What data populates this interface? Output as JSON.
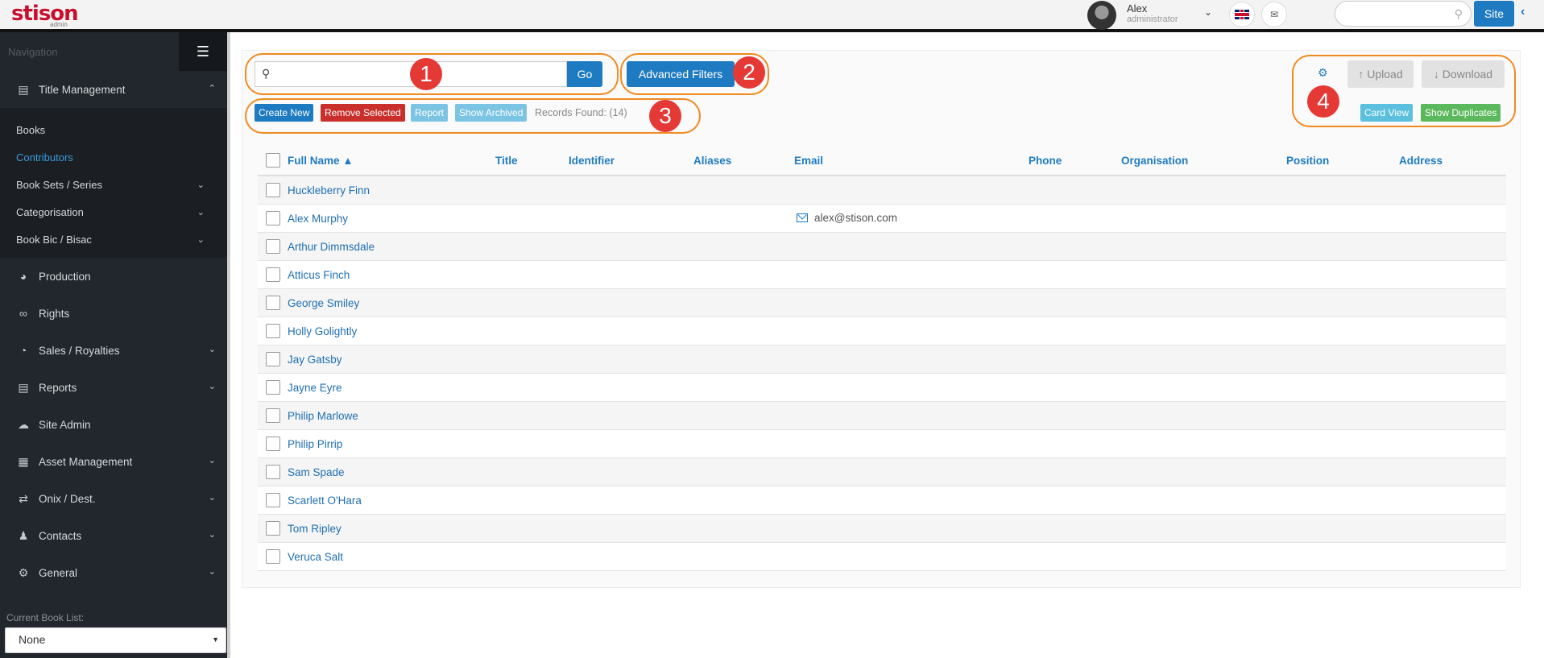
{
  "topbar": {
    "logo": "stison",
    "logo_sub": "admin",
    "user_name": "Alex",
    "user_role": "administrator",
    "search_placeholder": "",
    "site_label": "Site",
    "icons": {
      "caret": "chevron-down-icon",
      "flag": "uk-flag-icon",
      "mail": "envelope-icon",
      "search": "search-icon",
      "collapse": "chevron-left-icon"
    }
  },
  "sidebar": {
    "nav_title": "Navigation",
    "title_management": "Title Management",
    "title_sub": [
      {
        "label": "Books"
      },
      {
        "label": "Contributors",
        "active": true
      },
      {
        "label": "Book Sets / Series"
      },
      {
        "label": "Categorisation"
      },
      {
        "label": "Book Bic / Bisac"
      }
    ],
    "items": [
      {
        "label": "Production",
        "icon": "dashboard-icon"
      },
      {
        "label": "Rights",
        "icon": "link-icon"
      },
      {
        "label": "Sales / Royalties",
        "icon": "pie-chart-icon"
      },
      {
        "label": "Reports",
        "icon": "document-icon"
      },
      {
        "label": "Site Admin",
        "icon": "cloud-icon"
      },
      {
        "label": "Asset Management",
        "icon": "image-icon"
      },
      {
        "label": "Onix / Dest.",
        "icon": "exchange-icon"
      },
      {
        "label": "Contacts",
        "icon": "users-icon"
      },
      {
        "label": "General",
        "icon": "gears-icon"
      }
    ],
    "book_list_label": "Current Book List:",
    "book_list_value": "None"
  },
  "toolbar": {
    "search_value": "",
    "go_label": "Go",
    "advanced_filters_label": "Advanced Filters",
    "create_new_label": "Create New",
    "remove_selected_label": "Remove Selected",
    "report_label": "Report",
    "show_archived_label": "Show Archived",
    "records_found": "Records Found: (14)",
    "upload_label": "↑ Upload",
    "download_label": "↓ Download",
    "card_view_label": "Card View",
    "show_duplicates_label": "Show Duplicates"
  },
  "callouts": [
    "1",
    "2",
    "3",
    "4"
  ],
  "colors": {
    "primary": "#1f7bc1",
    "danger": "#c9302c",
    "info": "#5bc0de",
    "success": "#5cb85c",
    "callout_border": "#f08a1f",
    "badge": "#e53935",
    "sidebar_bg": "#22272d"
  },
  "table": {
    "columns": [
      "Full Name ▲",
      "Title",
      "Identifier",
      "Aliases",
      "Email",
      "Phone",
      "Organisation",
      "Position",
      "Address"
    ],
    "rows": [
      {
        "name": "Huckleberry Finn",
        "email": ""
      },
      {
        "name": "Alex Murphy",
        "email": "alex@stison.com"
      },
      {
        "name": "Arthur Dimmsdale",
        "email": ""
      },
      {
        "name": "Atticus Finch",
        "email": ""
      },
      {
        "name": "George Smiley",
        "email": ""
      },
      {
        "name": "Holly Golightly",
        "email": ""
      },
      {
        "name": "Jay Gatsby",
        "email": ""
      },
      {
        "name": "Jayne Eyre",
        "email": ""
      },
      {
        "name": "Philip Marlowe",
        "email": ""
      },
      {
        "name": "Philip Pirrip",
        "email": ""
      },
      {
        "name": "Sam Spade",
        "email": ""
      },
      {
        "name": "Scarlett O'Hara",
        "email": ""
      },
      {
        "name": "Tom Ripley",
        "email": ""
      },
      {
        "name": "Veruca Salt",
        "email": ""
      }
    ]
  }
}
